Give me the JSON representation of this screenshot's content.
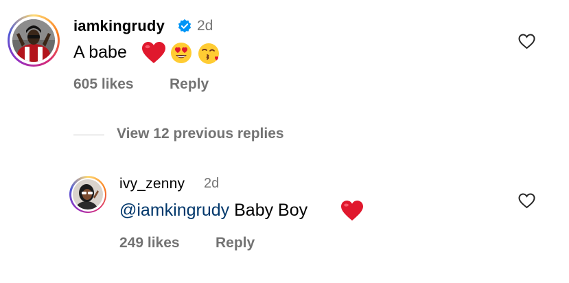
{
  "comment1": {
    "username": "iamkingrudy",
    "verified": true,
    "time": "2d",
    "text": "A babe",
    "emojis": [
      "red-heart",
      "heart-eyes-face",
      "face-blowing-kiss"
    ],
    "likes": "605 likes",
    "reply_label": "Reply"
  },
  "view_replies": {
    "label": "View 12 previous replies"
  },
  "comment2": {
    "username": "ivy_zenny",
    "time": "2d",
    "mention": "@iamkingrudy",
    "text": "Baby Boy",
    "emojis": [
      "red-heart"
    ],
    "likes": "249 likes",
    "reply_label": "Reply"
  },
  "colors": {
    "muted": "#737373",
    "mention": "#00376b",
    "verified": "#0095f6",
    "heart_emoji": "#e0182d"
  }
}
